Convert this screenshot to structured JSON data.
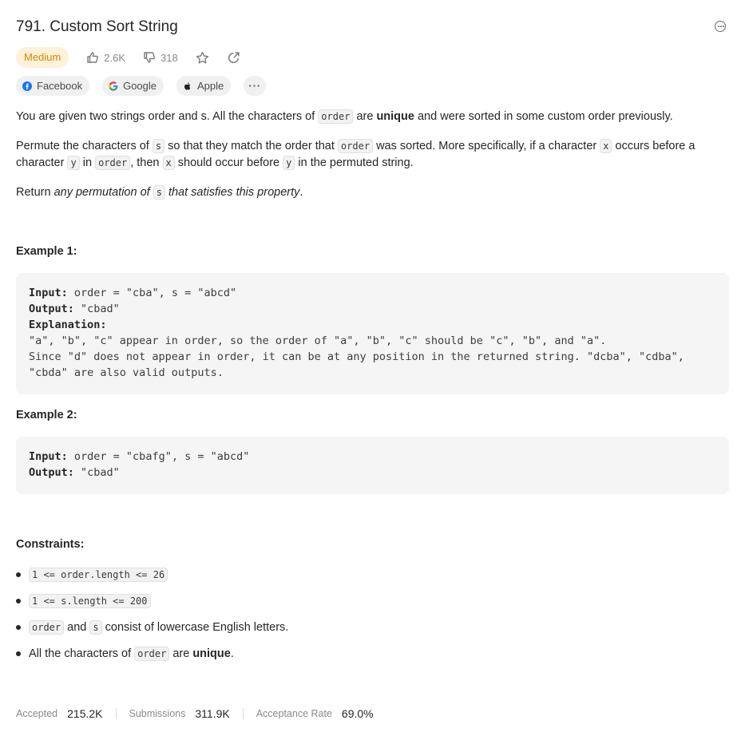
{
  "problem": {
    "title": "791. Custom Sort String",
    "difficulty": "Medium",
    "likes": "2.6K",
    "dislikes": "318"
  },
  "tags": [
    {
      "label": "Facebook",
      "icon": "facebook-icon"
    },
    {
      "label": "Google",
      "icon": "google-icon"
    },
    {
      "label": "Apple",
      "icon": "apple-icon"
    },
    {
      "label": "···",
      "icon": "more-icon"
    }
  ],
  "description": {
    "p1_a": "You are given two strings order and s. All the characters of ",
    "p1_code": "order",
    "p1_b": " are ",
    "p1_bold": "unique",
    "p1_c": " and were sorted in some custom order previously.",
    "p2_a": "Permute the characters of ",
    "p2_code1": "s",
    "p2_b": " so that they match the order that ",
    "p2_code2": "order",
    "p2_c": " was sorted. More specifically, if a character ",
    "p2_code3": "x",
    "p2_d": " occurs before a character ",
    "p2_code4": "y",
    "p2_e": " in ",
    "p2_code5": "order",
    "p2_f": ", then ",
    "p2_code6": "x",
    "p2_g": " should occur before ",
    "p2_code7": "y",
    "p2_h": " in the permuted string.",
    "p3_a": "Return ",
    "p3_em1": "any permutation of ",
    "p3_code": "s",
    "p3_em2": " that satisfies this property",
    "p3_b": "."
  },
  "examples": [
    {
      "heading": "Example 1:",
      "input_label": "Input:",
      "input": " order = \"cba\", s = \"abcd\"",
      "output_label": "Output:",
      "output": " \"cbad\"",
      "explanation_label": "Explanation:",
      "explanation_1": "\"a\", \"b\", \"c\" appear in order, so the order of \"a\", \"b\", \"c\" should be \"c\", \"b\", and \"a\".",
      "explanation_2": "Since \"d\" does not appear in order, it can be at any position in the returned string. \"dcba\", \"cdba\",",
      "explanation_3": "\"cbda\" are also valid outputs."
    },
    {
      "heading": "Example 2:",
      "input_label": "Input:",
      "input": " order = \"cbafg\", s = \"abcd\"",
      "output_label": "Output:",
      "output": " \"cbad\""
    }
  ],
  "constraints": {
    "heading": "Constraints:",
    "c1_code": "1 <= order.length <= 26",
    "c2_code": "1 <= s.length <= 200",
    "c3_code1": "order",
    "c3_a": " and ",
    "c3_code2": "s",
    "c3_b": " consist of lowercase English letters.",
    "c4_a": "All the characters of ",
    "c4_code": "order",
    "c4_b": " are ",
    "c4_bold": "unique",
    "c4_c": "."
  },
  "stats": {
    "accepted_label": "Accepted",
    "accepted": "215.2K",
    "submissions_label": "Submissions",
    "submissions": "311.9K",
    "rate_label": "Acceptance Rate",
    "rate": "69.0%"
  },
  "colors": {
    "difficulty_bg": "#fdf2d9",
    "difficulty_fg": "#d48806",
    "code_bg": "#f5f5f5"
  }
}
